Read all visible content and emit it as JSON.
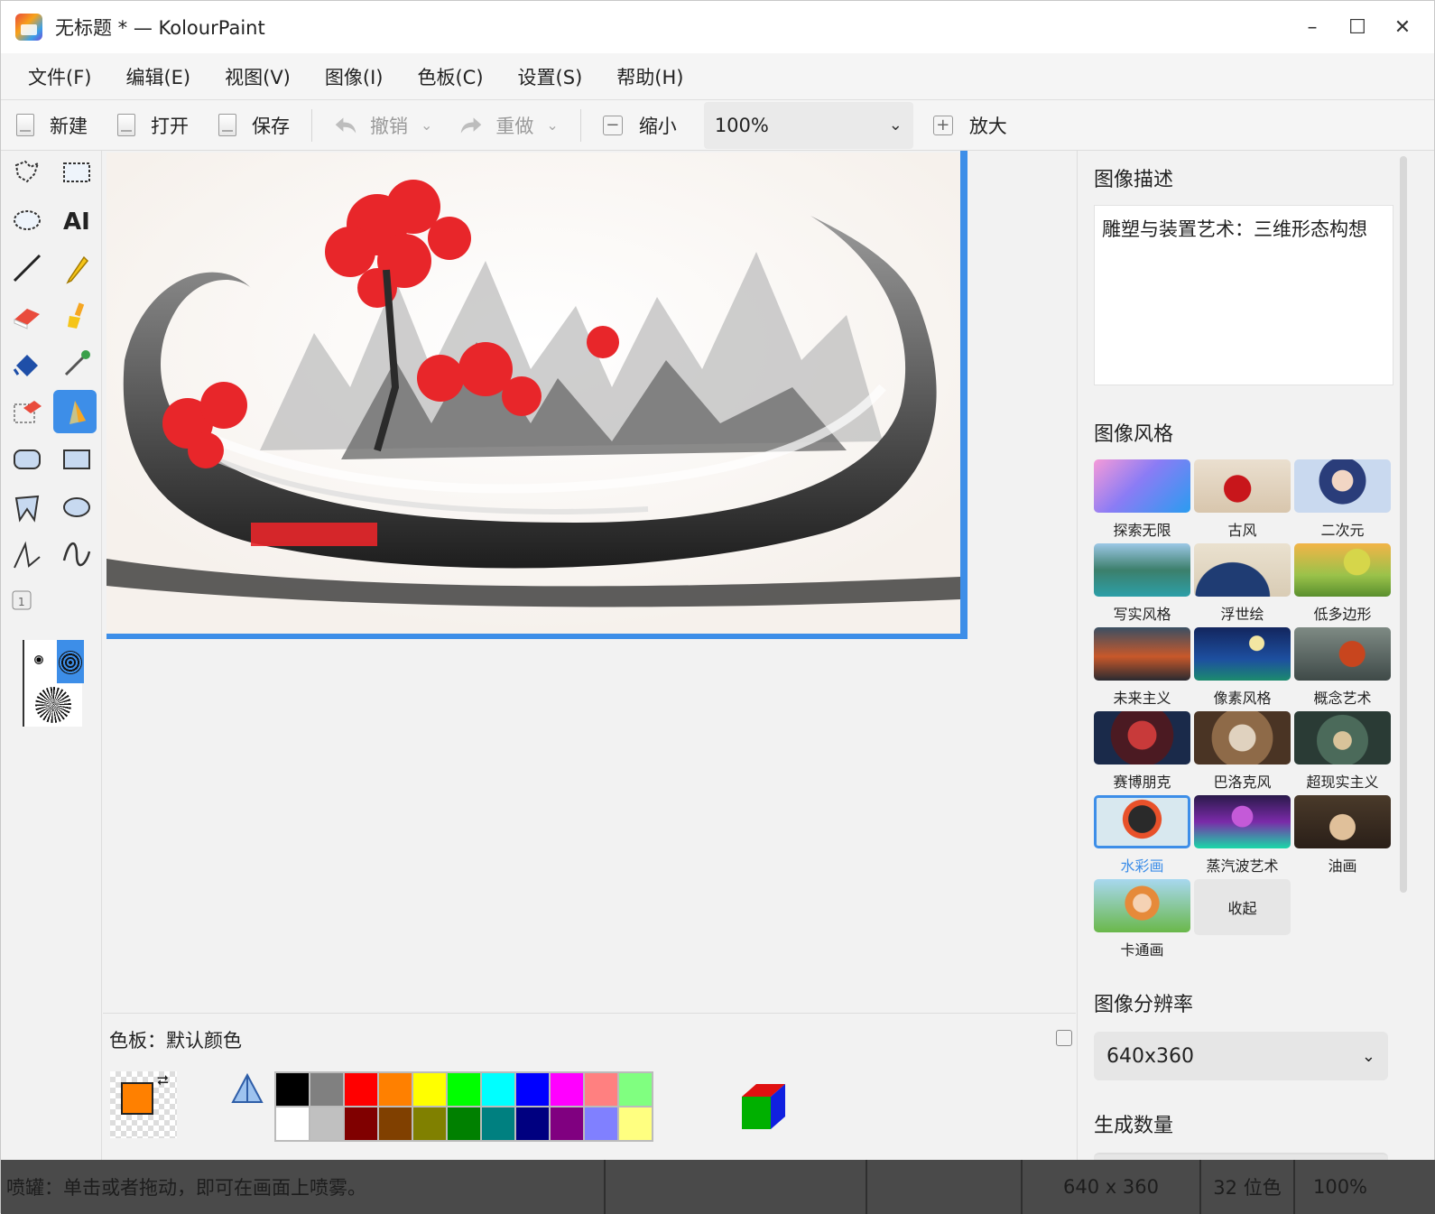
{
  "window": {
    "title": "无标题 * — KolourPaint",
    "controls": {
      "minimize": "–",
      "maximize": "☐",
      "close": "✕"
    }
  },
  "menu": [
    "文件(F)",
    "编辑(E)",
    "视图(V)",
    "图像(I)",
    "色板(C)",
    "设置(S)",
    "帮助(H)"
  ],
  "toolbar": {
    "new_label": "新建",
    "open_label": "打开",
    "save_label": "保存",
    "undo_label": "撤销",
    "redo_label": "重做",
    "zoom_out_label": "缩小",
    "zoom_value": "100%",
    "zoom_in_label": "放大"
  },
  "palette": {
    "title": "色板：默认颜色",
    "foreground": "#ff8000",
    "background": "#ffffff",
    "row1": [
      "#000000",
      "#808080",
      "#ff0000",
      "#ff8000",
      "#ffff00",
      "#00ff00",
      "#00ffff",
      "#0000ff",
      "#ff00ff",
      "#ff8080",
      "#80ff80"
    ],
    "row2": [
      "#ffffff",
      "#c0c0c0",
      "#800000",
      "#804000",
      "#808000",
      "#008000",
      "#008080",
      "#000080",
      "#800080",
      "#8080ff",
      "#ffff80"
    ]
  },
  "right_panel": {
    "desc_heading": "图像描述",
    "desc_text": "雕塑与装置艺术：三维形态构想",
    "style_heading": "图像风格",
    "styles": [
      {
        "label": "探索无限"
      },
      {
        "label": "古风"
      },
      {
        "label": "二次元"
      },
      {
        "label": "写实风格"
      },
      {
        "label": "浮世绘"
      },
      {
        "label": "低多边形"
      },
      {
        "label": "未来主义"
      },
      {
        "label": "像素风格"
      },
      {
        "label": "概念艺术"
      },
      {
        "label": "赛博朋克"
      },
      {
        "label": "巴洛克风"
      },
      {
        "label": "超现实主义"
      },
      {
        "label": "水彩画"
      },
      {
        "label": "蒸汽波艺术"
      },
      {
        "label": "油画"
      },
      {
        "label": "卡通画"
      }
    ],
    "collapse_label": "收起",
    "resolution_heading": "图像分辨率",
    "resolution_value": "640x360",
    "count_heading": "生成数量"
  },
  "statusbar": {
    "message": "喷罐：单击或者拖动，即可在画面上喷雾。",
    "size": "640 x 360",
    "depth": "32 位色",
    "zoom": "100%"
  },
  "accent_color": "#3d8ee8"
}
